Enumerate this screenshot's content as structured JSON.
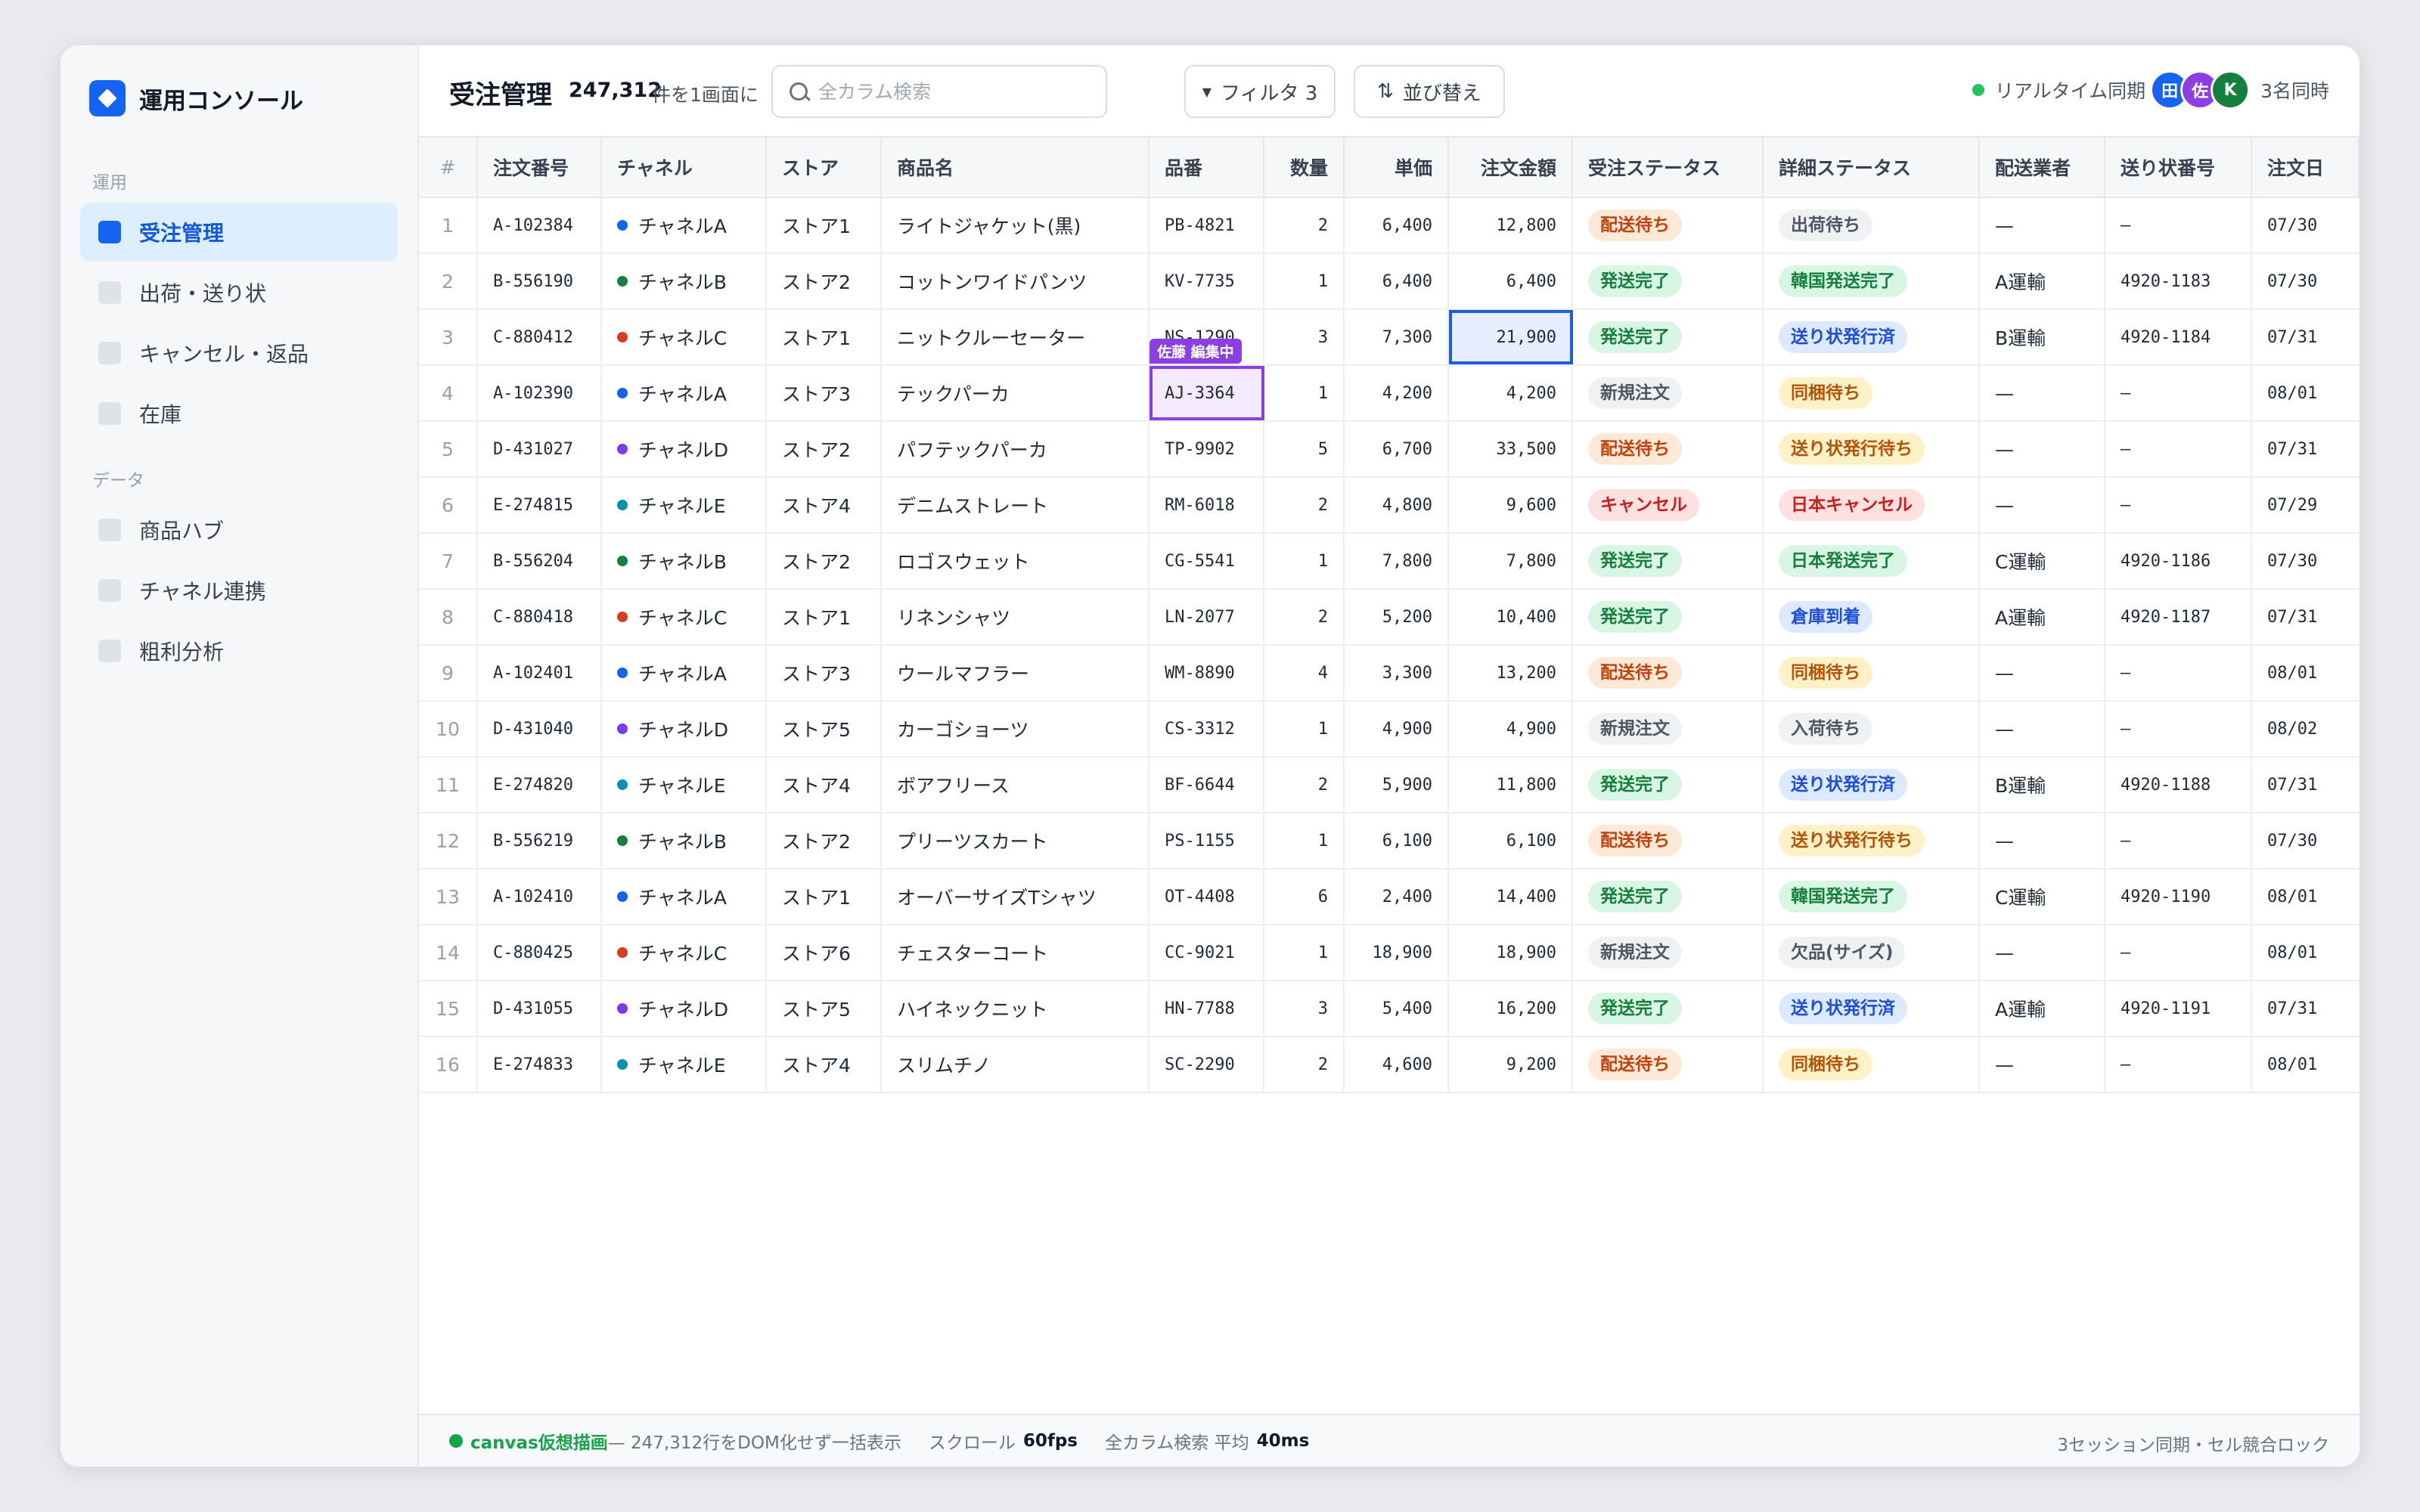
{
  "app": {
    "name": "運用コンソール"
  },
  "sidebar": {
    "sections": [
      {
        "label": "運用",
        "items": [
          {
            "label": "受注管理",
            "active": true
          },
          {
            "label": "出荷・送り状",
            "active": false
          },
          {
            "label": "キャンセル・返品",
            "active": false
          },
          {
            "label": "在庫",
            "active": false
          }
        ]
      },
      {
        "label": "データ",
        "items": [
          {
            "label": "商品ハブ",
            "active": false
          },
          {
            "label": "チャネル連携",
            "active": false
          },
          {
            "label": "粗利分析",
            "active": false
          }
        ]
      }
    ]
  },
  "header": {
    "title": "受注管理",
    "row_count": "247,312",
    "row_count_suffix": "件を1画面に",
    "search_placeholder": "全カラム検索",
    "filter_label": "フィルタ 3",
    "sort_label": "並び替え",
    "sync_label": "リアルタイム同期",
    "avatars": [
      {
        "initial": "田",
        "color": "#1463f3"
      },
      {
        "initial": "佐",
        "color": "#8b3fe0"
      },
      {
        "initial": "K",
        "color": "#15803d"
      }
    ],
    "concurrent": "3名同時"
  },
  "colors": {
    "accent": "#1463f3",
    "channels": {
      "チャネルA": "#1463f3",
      "チャネルB": "#15803d",
      "チャネルC": "#dc3c1e",
      "チャネルD": "#7c3aed",
      "チャネルE": "#0891b2"
    },
    "status": {
      "配送待ち": {
        "bg": "#fde9d8",
        "fg": "#c2410c"
      },
      "発送完了": {
        "bg": "#d9f5e3",
        "fg": "#15803d"
      },
      "新規注文": {
        "bg": "#f0f1f3",
        "fg": "#4b5563"
      },
      "キャンセル": {
        "bg": "#fde0e0",
        "fg": "#c81e1e"
      },
      "出荷待ち": {
        "bg": "#f0f1f3",
        "fg": "#4b5563"
      },
      "入荷待ち": {
        "bg": "#f0f1f3",
        "fg": "#4b5563"
      },
      "欠品(サイズ)": {
        "bg": "#f0f1f3",
        "fg": "#4b5563"
      },
      "韓国発送完了": {
        "bg": "#d9f5e3",
        "fg": "#15803d"
      },
      "日本発送完了": {
        "bg": "#d9f5e3",
        "fg": "#15803d"
      },
      "送り状発行済": {
        "bg": "#dde9fe",
        "fg": "#1d4ed8"
      },
      "倉庫到着": {
        "bg": "#dde9fe",
        "fg": "#1d4ed8"
      },
      "同梱待ち": {
        "bg": "#fdf1c7",
        "fg": "#b45309"
      },
      "送り状発行待ち": {
        "bg": "#fdf1c7",
        "fg": "#b45309"
      },
      "日本キャンセル": {
        "bg": "#fde0e0",
        "fg": "#c81e1e"
      }
    }
  },
  "table": {
    "columns": [
      "#",
      "注文番号",
      "チャネル",
      "ストア",
      "商品名",
      "品番",
      "数量",
      "単価",
      "注文金額",
      "受注ステータス",
      "詳細ステータス",
      "配送業者",
      "送り状番号",
      "注文日"
    ],
    "rows": [
      {
        "idx": "1",
        "order": "A-102384",
        "channel": "チャネルA",
        "store": "ストア1",
        "product": "ライトジャケット(黒)",
        "sku": "PB-4821",
        "qty": "2",
        "unit": "6,400",
        "amount": "12,800",
        "order_status": "配送待ち",
        "detail_status": "出荷待ち",
        "carrier": "—",
        "tracking": "—",
        "date": "07/30"
      },
      {
        "idx": "2",
        "order": "B-556190",
        "channel": "チャネルB",
        "store": "ストア2",
        "product": "コットンワイドパンツ",
        "sku": "KV-7735",
        "qty": "1",
        "unit": "6,400",
        "amount": "6,400",
        "order_status": "発送完了",
        "detail_status": "韓国発送完了",
        "carrier": "A運輸",
        "tracking": "4920-1183",
        "date": "07/30"
      },
      {
        "idx": "3",
        "order": "C-880412",
        "channel": "チャネルC",
        "store": "ストア1",
        "product": "ニットクルーセーター",
        "sku": "NS-1290",
        "qty": "3",
        "unit": "7,300",
        "amount": "21,900",
        "order_status": "発送完了",
        "detail_status": "送り状発行済",
        "carrier": "B運輸",
        "tracking": "4920-1184",
        "date": "07/31",
        "selected": "amount"
      },
      {
        "idx": "4",
        "order": "A-102390",
        "channel": "チャネルA",
        "store": "ストア3",
        "product": "テックパーカ",
        "sku": "AJ-3364",
        "qty": "1",
        "unit": "4,200",
        "amount": "4,200",
        "order_status": "新規注文",
        "detail_status": "同梱待ち",
        "carrier": "—",
        "tracking": "—",
        "date": "08/01",
        "editing": "sku",
        "editing_label": "佐藤 編集中"
      },
      {
        "idx": "5",
        "order": "D-431027",
        "channel": "チャネルD",
        "store": "ストア2",
        "product": "パフテックパーカ",
        "sku": "TP-9902",
        "qty": "5",
        "unit": "6,700",
        "amount": "33,500",
        "order_status": "配送待ち",
        "detail_status": "送り状発行待ち",
        "carrier": "—",
        "tracking": "—",
        "date": "07/31"
      },
      {
        "idx": "6",
        "order": "E-274815",
        "channel": "チャネルE",
        "store": "ストア4",
        "product": "デニムストレート",
        "sku": "RM-6018",
        "qty": "2",
        "unit": "4,800",
        "amount": "9,600",
        "order_status": "キャンセル",
        "detail_status": "日本キャンセル",
        "carrier": "—",
        "tracking": "—",
        "date": "07/29"
      },
      {
        "idx": "7",
        "order": "B-556204",
        "channel": "チャネルB",
        "store": "ストア2",
        "product": "ロゴスウェット",
        "sku": "CG-5541",
        "qty": "1",
        "unit": "7,800",
        "amount": "7,800",
        "order_status": "発送完了",
        "detail_status": "日本発送完了",
        "carrier": "C運輸",
        "tracking": "4920-1186",
        "date": "07/30"
      },
      {
        "idx": "8",
        "order": "C-880418",
        "channel": "チャネルC",
        "store": "ストア1",
        "product": "リネンシャツ",
        "sku": "LN-2077",
        "qty": "2",
        "unit": "5,200",
        "amount": "10,400",
        "order_status": "発送完了",
        "detail_status": "倉庫到着",
        "carrier": "A運輸",
        "tracking": "4920-1187",
        "date": "07/31"
      },
      {
        "idx": "9",
        "order": "A-102401",
        "channel": "チャネルA",
        "store": "ストア3",
        "product": "ウールマフラー",
        "sku": "WM-8890",
        "qty": "4",
        "unit": "3,300",
        "amount": "13,200",
        "order_status": "配送待ち",
        "detail_status": "同梱待ち",
        "carrier": "—",
        "tracking": "—",
        "date": "08/01"
      },
      {
        "idx": "10",
        "order": "D-431040",
        "channel": "チャネルD",
        "store": "ストア5",
        "product": "カーゴショーツ",
        "sku": "CS-3312",
        "qty": "1",
        "unit": "4,900",
        "amount": "4,900",
        "order_status": "新規注文",
        "detail_status": "入荷待ち",
        "carrier": "—",
        "tracking": "—",
        "date": "08/02"
      },
      {
        "idx": "11",
        "order": "E-274820",
        "channel": "チャネルE",
        "store": "ストア4",
        "product": "ボアフリース",
        "sku": "BF-6644",
        "qty": "2",
        "unit": "5,900",
        "amount": "11,800",
        "order_status": "発送完了",
        "detail_status": "送り状発行済",
        "carrier": "B運輸",
        "tracking": "4920-1188",
        "date": "07/31"
      },
      {
        "idx": "12",
        "order": "B-556219",
        "channel": "チャネルB",
        "store": "ストア2",
        "product": "プリーツスカート",
        "sku": "PS-1155",
        "qty": "1",
        "unit": "6,100",
        "amount": "6,100",
        "order_status": "配送待ち",
        "detail_status": "送り状発行待ち",
        "carrier": "—",
        "tracking": "—",
        "date": "07/30"
      },
      {
        "idx": "13",
        "order": "A-102410",
        "channel": "チャネルA",
        "store": "ストア1",
        "product": "オーバーサイズTシャツ",
        "sku": "OT-4408",
        "qty": "6",
        "unit": "2,400",
        "amount": "14,400",
        "order_status": "発送完了",
        "detail_status": "韓国発送完了",
        "carrier": "C運輸",
        "tracking": "4920-1190",
        "date": "08/01"
      },
      {
        "idx": "14",
        "order": "C-880425",
        "channel": "チャネルC",
        "store": "ストア6",
        "product": "チェスターコート",
        "sku": "CC-9021",
        "qty": "1",
        "unit": "18,900",
        "amount": "18,900",
        "order_status": "新規注文",
        "detail_status": "欠品(サイズ)",
        "carrier": "—",
        "tracking": "—",
        "date": "08/01"
      },
      {
        "idx": "15",
        "order": "D-431055",
        "channel": "チャネルD",
        "store": "ストア5",
        "product": "ハイネックニット",
        "sku": "HN-7788",
        "qty": "3",
        "unit": "5,400",
        "amount": "16,200",
        "order_status": "発送完了",
        "detail_status": "送り状発行済",
        "carrier": "A運輸",
        "tracking": "4920-1191",
        "date": "07/31"
      },
      {
        "idx": "16",
        "order": "E-274833",
        "channel": "チャネルE",
        "store": "ストア4",
        "product": "スリムチノ",
        "sku": "SC-2290",
        "qty": "2",
        "unit": "4,600",
        "amount": "9,200",
        "order_status": "配送待ち",
        "detail_status": "同梱待ち",
        "carrier": "—",
        "tracking": "—",
        "date": "08/01"
      }
    ]
  },
  "footer": {
    "canvas_label": "canvas仮想描画",
    "canvas_desc": " — 247,312行をDOM化せず一括表示",
    "scroll_label": "スクロール",
    "scroll_value": "60fps",
    "search_label": "全カラム検索 平均",
    "search_value": "40ms",
    "right": "3セッション同期・セル競合ロック"
  }
}
